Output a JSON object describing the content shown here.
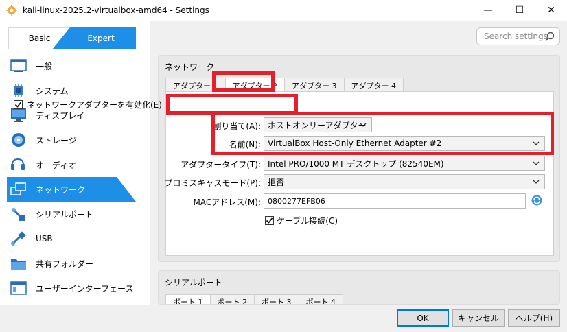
{
  "window": {
    "title": "kali-linux-2025.2-virtualbox-amd64 - Settings",
    "minimize": "—",
    "maximize": "☐",
    "close": "✕"
  },
  "mode": {
    "basic": "Basic",
    "expert": "Expert"
  },
  "search": {
    "placeholder": "Search settings"
  },
  "nav": [
    {
      "label": "一般",
      "icon": "general-icon"
    },
    {
      "label": "システム",
      "icon": "system-icon"
    },
    {
      "label": "ディスプレイ",
      "icon": "display-icon"
    },
    {
      "label": "ストレージ",
      "icon": "storage-icon"
    },
    {
      "label": "オーディオ",
      "icon": "audio-icon"
    },
    {
      "label": "ネットワーク",
      "icon": "network-icon",
      "active": true
    },
    {
      "label": "シリアルポート",
      "icon": "serial-port-icon"
    },
    {
      "label": "USB",
      "icon": "usb-icon"
    },
    {
      "label": "共有フォルダー",
      "icon": "shared-folder-icon"
    },
    {
      "label": "ユーザーインターフェース",
      "icon": "user-interface-icon"
    }
  ],
  "network": {
    "title": "ネットワーク",
    "tabs": [
      "アダプター 1",
      "アダプター 2",
      "アダプター 3",
      "アダプター 4"
    ],
    "selected_tab": 1,
    "enable_label": "ネットワークアダプターを有効化(E)",
    "attached_label": "割り当て(A):",
    "attached_value": "ホストオンリーアダプター",
    "name_label": "名前(N):",
    "name_value": "VirtualBox Host-Only Ethernet Adapter #2",
    "adapter_type_label": "アダプタータイプ(T):",
    "adapter_type_value": "Intel PRO/1000 MT デスクトップ (82540EM)",
    "promisc_label": "プロミスキャスモード(P):",
    "promisc_value": "拒否",
    "mac_label": "MACアドレス(M):",
    "mac_value": "0800277EFB06",
    "cable_label": "ケーブル接続(C)"
  },
  "serial": {
    "title": "シリアルポート",
    "tabs": [
      "ポート 1",
      "ポート 2",
      "ポート 3",
      "ポート 4"
    ]
  },
  "footer": {
    "ok": "OK",
    "cancel": "キャンセル",
    "help": "ヘルプ(H)"
  },
  "colors": {
    "accent": "#1e8fe6",
    "highlight_red": "#e5202c"
  }
}
